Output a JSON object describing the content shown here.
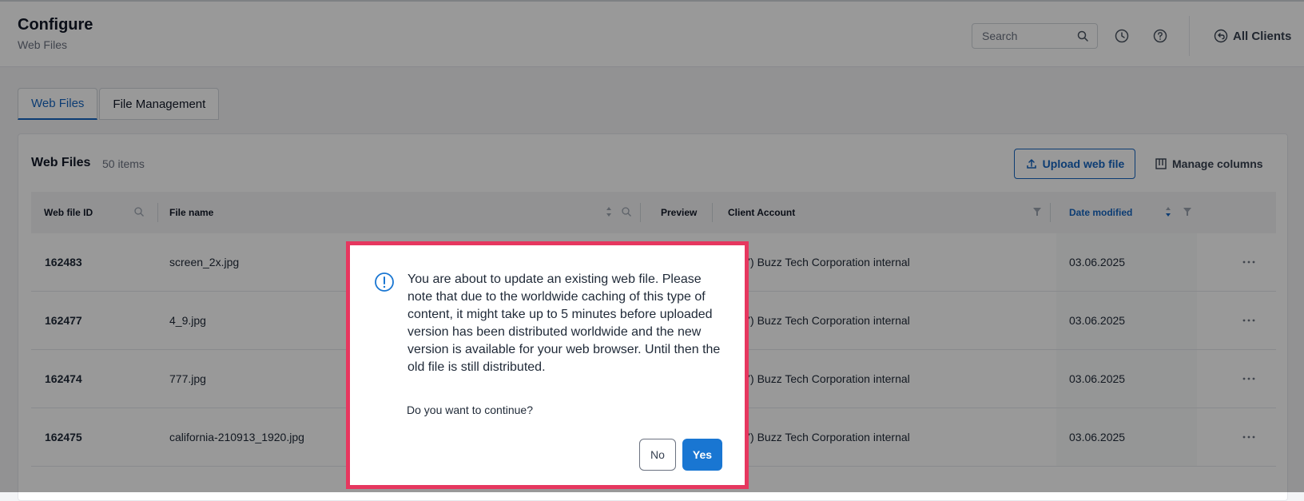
{
  "header": {
    "title": "Configure",
    "subtitle": "Web Files",
    "search_placeholder": "Search",
    "all_clients_label": "All Clients"
  },
  "tabs": [
    {
      "label": "Web Files",
      "active": true
    },
    {
      "label": "File Management",
      "active": false
    }
  ],
  "panel": {
    "title": "Web Files",
    "count": "50 items",
    "upload_label": "Upload web file",
    "manage_columns_label": "Manage columns"
  },
  "table": {
    "columns": [
      "Web file ID",
      "File name",
      "Preview",
      "Client Account",
      "Date modified"
    ],
    "rows": [
      {
        "id": "162483",
        "file_name": "screen_2x.jpg",
        "client": "(777) Buzz Tech Corporation internal",
        "date": "03.06.2025"
      },
      {
        "id": "162477",
        "file_name": "4_9.jpg",
        "client": "(777) Buzz Tech Corporation internal",
        "date": "03.06.2025"
      },
      {
        "id": "162474",
        "file_name": "777.jpg",
        "client": "(777) Buzz Tech Corporation internal",
        "date": "03.06.2025"
      },
      {
        "id": "162475",
        "file_name": "california-210913_1920.jpg",
        "client": "(777) Buzz Tech Corporation internal",
        "date": "03.06.2025"
      }
    ]
  },
  "dialog": {
    "message": "You are about to update an existing web file. Please note that due to the worldwide caching of this type of content, it might take up to 5 minutes before uploaded version has been distributed worldwide and the new version is available for your web browser. Until then the old file is still distributed.",
    "question": "Do you want to continue?",
    "no_label": "No",
    "yes_label": "Yes"
  },
  "colors": {
    "accent": "#1565c0",
    "primary_button": "#1976d2",
    "dialog_highlight": "#e6375f"
  },
  "icons": [
    "search-icon",
    "history-icon",
    "help-icon",
    "back-arrow-icon",
    "upload-icon",
    "columns-icon",
    "sort-icon",
    "filter-icon",
    "more-icon",
    "alert-icon"
  ]
}
